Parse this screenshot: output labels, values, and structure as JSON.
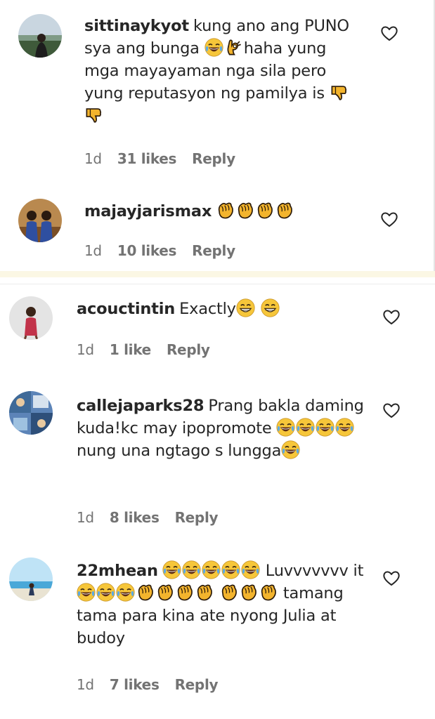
{
  "comments": [
    {
      "username": "sittinaykyot",
      "text_parts": [
        "kung ano ang PUNO sya ang bunga",
        "haha yung mga mayayaman nga sila pero yung reputasyon ng pamilya is"
      ],
      "age": "1d",
      "likes": "31 likes",
      "reply": "Reply",
      "icons": [
        "joy-emoji",
        "ok-hand-emoji",
        "thumbs-down-emoji"
      ]
    },
    {
      "username": "majayjarismax",
      "text_parts": [],
      "age": "1d",
      "likes": "10 likes",
      "reply": "Reply",
      "icons": [
        "clap-emoji"
      ]
    },
    {
      "username": "acouctintin",
      "text_parts": [
        "Exactly"
      ],
      "age": "1d",
      "likes": "1 like",
      "reply": "Reply",
      "icons": [
        "grin-emoji"
      ]
    },
    {
      "username": "callejaparks28",
      "text_parts": [
        "Prang bakla daming kuda!kc may ipopromote",
        "nung una ngtago s lungga"
      ],
      "age": "1d",
      "likes": "8 likes",
      "reply": "Reply",
      "icons": [
        "joy-emoji"
      ]
    },
    {
      "username": "22mhean",
      "text_parts": [
        "Luvvvvvvv it",
        "tamang tama para kina ate nyong Julia at budoy"
      ],
      "age": "1d",
      "likes": "7 likes",
      "reply": "Reply",
      "icons": [
        "joy-emoji",
        "clap-emoji"
      ]
    }
  ],
  "colors": {
    "text": "#262626",
    "meta": "#737373",
    "emoji_yellow": "#f6c63a",
    "divider_tint": "#fbf7e4"
  },
  "icons": {
    "like": "heart-outline-icon"
  }
}
